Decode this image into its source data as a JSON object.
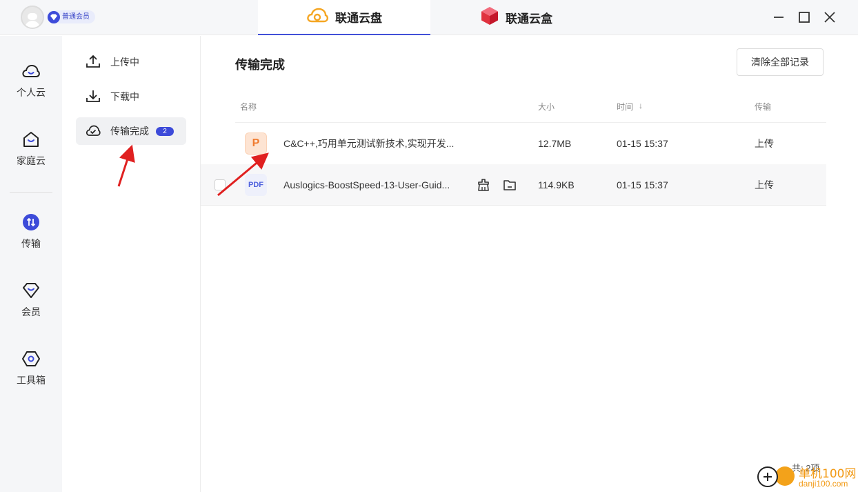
{
  "user": {
    "vip_label": "普通会员"
  },
  "app_tabs": [
    {
      "label": "联通云盘",
      "active": true,
      "icon": "cloud-icon"
    },
    {
      "label": "联通云盒",
      "active": false,
      "icon": "cube-icon"
    }
  ],
  "left_nav": [
    {
      "label": "个人云",
      "icon": "cloud-outline-icon"
    },
    {
      "label": "家庭云",
      "icon": "home-cloud-icon"
    },
    {
      "label": "传输",
      "icon": "transfer-icon",
      "active": true
    },
    {
      "label": "会员",
      "icon": "diamond-icon"
    },
    {
      "label": "工具箱",
      "icon": "toolbox-icon"
    }
  ],
  "submenu": [
    {
      "label": "上传中",
      "icon": "upload-icon"
    },
    {
      "label": "下载中",
      "icon": "download-icon"
    },
    {
      "label": "传输完成",
      "icon": "check-cloud-icon",
      "badge": "2",
      "active": true
    }
  ],
  "main": {
    "title": "传输完成",
    "clear_button": "清除全部记录",
    "columns": {
      "name": "名称",
      "size": "大小",
      "time": "时间",
      "sort_indicator": "↓",
      "transfer": "传输"
    },
    "rows": [
      {
        "icon_text": "P",
        "type": "ppt",
        "name": "C&C++,巧用单元测试新技术,实现开发...",
        "size": "12.7MB",
        "time": "01-15 15:37",
        "transfer": "上传"
      },
      {
        "icon_text": "PDF",
        "type": "pdf",
        "name": "Auslogics-BoostSpeed-13-User-Guid...",
        "size": "114.9KB",
        "time": "01-15 15:37",
        "transfer": "上传"
      }
    ],
    "footer_count": "共: 2项"
  },
  "watermark": {
    "text": "单机100网",
    "sub": "danji100.com"
  },
  "colors": {
    "accent": "#3d4bd9",
    "annotation_arrow": "#e02020",
    "cloud_orange": "#f5a623"
  }
}
